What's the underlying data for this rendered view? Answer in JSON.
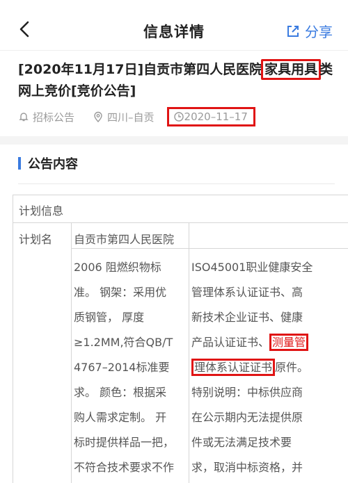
{
  "nav": {
    "title": "信息详情",
    "share_label": "分享"
  },
  "title": {
    "part1": "[2020年11月17日]自贡市第四人民医院",
    "highlight": "家具用具",
    "part2": "类网上竞价[竞价公告]"
  },
  "meta": {
    "category": "招标公告",
    "location": "四川–自贡",
    "date": "2020–11–17"
  },
  "section": {
    "title": "公告内容"
  },
  "table": {
    "plan_info": "计划信息",
    "plan_name_label": "计划名",
    "plan_name_value": "自贡市第四人民医院",
    "mid_lines": [
      "2006 阻燃织物标",
      "准。 钢架：采用优",
      "质钢管， 厚度",
      "≥1.2MM,符合QB/T",
      "4767–2014标准要",
      "求。 颜色：根据采",
      "购人需求定制。 开",
      "标时提供样品一把，",
      "不符合技术要求不作"
    ],
    "right_lines": {
      "l1": "ISO45001职业健康安全",
      "l2": "管理体系认证证书、高",
      "l3": "新技术企业证书、健康",
      "l4_a": "产品认证证书、",
      "l4_hl": "测量管",
      "l5_hl": "理体系认证证书",
      "l5_b": "原件。",
      "l6": "特别说明：中标供应商",
      "l7": "在公示期内无法提供原",
      "l8": "件或无法满足技术要",
      "l9": "求，取消中标资格，并"
    }
  }
}
